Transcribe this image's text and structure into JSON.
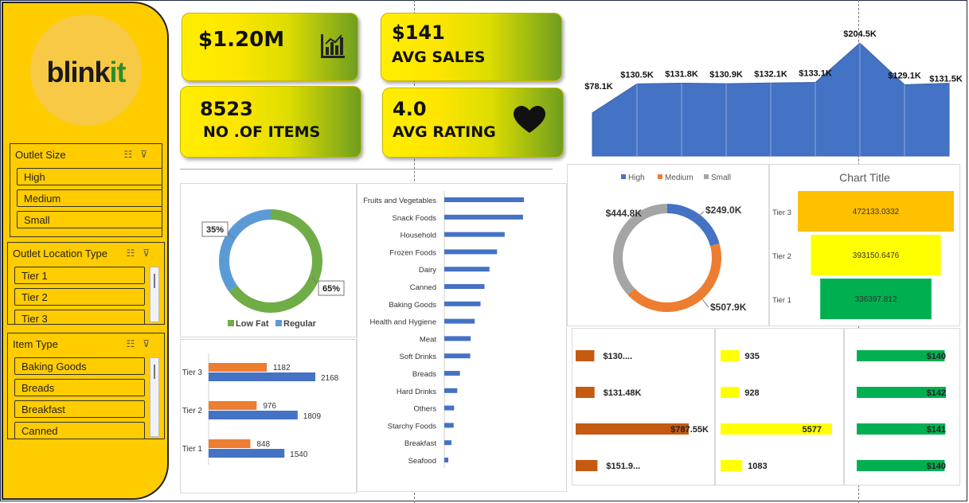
{
  "brand": {
    "name_part1": "blink",
    "name_part2": "it"
  },
  "slicers": {
    "outlet_size": {
      "title": "Outlet Size",
      "items": [
        "High",
        "Medium",
        "Small"
      ]
    },
    "outlet_location": {
      "title": "Outlet Location Type",
      "items": [
        "Tier 1",
        "Tier 2",
        "Tier 3"
      ]
    },
    "item_type": {
      "title": "Item Type",
      "items": [
        "Baking Goods",
        "Breads",
        "Breakfast",
        "Canned"
      ]
    }
  },
  "kpis": {
    "total_sales": {
      "value": "$1.20M"
    },
    "avg_sales": {
      "value": "$141",
      "label": "AVG SALES"
    },
    "items": {
      "value": "8523",
      "label": "NO .OF ITEMS"
    },
    "avg_rating": {
      "value": "4.0",
      "label": "AVG RATING"
    }
  },
  "icons": [
    "bar-chart-icon",
    "heart-icon",
    "filter-multiselect-icon",
    "clear-filter-icon"
  ],
  "colors": {
    "sidebar": "#ffcc00",
    "blue": "#4472c4",
    "orange": "#ed7d31",
    "green": "#70ad47",
    "lightblue": "#5b9bd5",
    "gray": "#a5a5a5",
    "rust": "#c55a11",
    "yellow": "#ffff00",
    "emerald": "#00b050",
    "gold": "#ffc000"
  },
  "chart_data": [
    {
      "id": "area",
      "type": "area",
      "labels": [
        "$78.1K",
        "$130.5K",
        "$131.8K",
        "$130.9K",
        "$132.1K",
        "$133.1K",
        "$204.5K",
        "$129.1K",
        "$131.5K"
      ],
      "values": [
        78.1,
        130.5,
        131.8,
        130.9,
        132.1,
        133.1,
        204.5,
        129.1,
        131.5
      ]
    },
    {
      "id": "fat_donut",
      "type": "pie",
      "series": [
        {
          "name": "Low Fat",
          "value": 65,
          "label": "65%"
        },
        {
          "name": "Regular",
          "value": 35,
          "label": "35%"
        }
      ]
    },
    {
      "id": "item_type_bar",
      "type": "bar",
      "categories": [
        "Fruits and Vegetables",
        "Snack Foods",
        "Household",
        "Frozen Foods",
        "Dairy",
        "Canned",
        "Baking Goods",
        "Health and Hygiene",
        "Meat",
        "Soft Drinks",
        "Breads",
        "Hard Drinks",
        "Others",
        "Starchy Foods",
        "Breakfast",
        "Seafood"
      ],
      "values": [
        178,
        176,
        135,
        118,
        101,
        90,
        81,
        68,
        59,
        58,
        35,
        29,
        22,
        21,
        16,
        9
      ]
    },
    {
      "id": "tier_fat_bar",
      "type": "bar",
      "categories": [
        "Tier 3",
        "Tier 2",
        "Tier 1"
      ],
      "series": [
        {
          "name": "Regular",
          "values": [
            1182,
            976,
            848
          ]
        },
        {
          "name": "Low Fat",
          "values": [
            2168,
            1809,
            1540
          ]
        }
      ]
    },
    {
      "id": "size_donut",
      "type": "pie",
      "legend": [
        "High",
        "Medium",
        "Small"
      ],
      "series": [
        {
          "name": "High",
          "value": 249.0,
          "label": "$249.0K"
        },
        {
          "name": "Medium",
          "value": 507.9,
          "label": "$507.9K"
        },
        {
          "name": "Small",
          "value": 444.8,
          "label": "$444.8K"
        }
      ]
    },
    {
      "id": "funnel",
      "type": "bar",
      "title": "Chart Title",
      "categories": [
        "Tier 3",
        "Tier 2",
        "Tier 1"
      ],
      "values": [
        472133.0332,
        393150.6476,
        336397.812
      ],
      "labels": [
        "472133.0332",
        "393150.6476",
        "336397.812"
      ]
    },
    {
      "id": "rust_bar",
      "type": "bar",
      "values": [
        130.0,
        131.48,
        787.55,
        151.9
      ],
      "labels": [
        "$130....",
        "$131.48K",
        "$787.55K",
        "$151.9..."
      ]
    },
    {
      "id": "yellow_bar",
      "type": "bar",
      "values": [
        935,
        928,
        5577,
        1083
      ],
      "labels": [
        "935",
        "928",
        "5577",
        "1083"
      ]
    },
    {
      "id": "green_bar",
      "type": "bar",
      "values": [
        140,
        142,
        141,
        140
      ],
      "labels": [
        "$140",
        "$142",
        "$141",
        "$140"
      ]
    }
  ]
}
